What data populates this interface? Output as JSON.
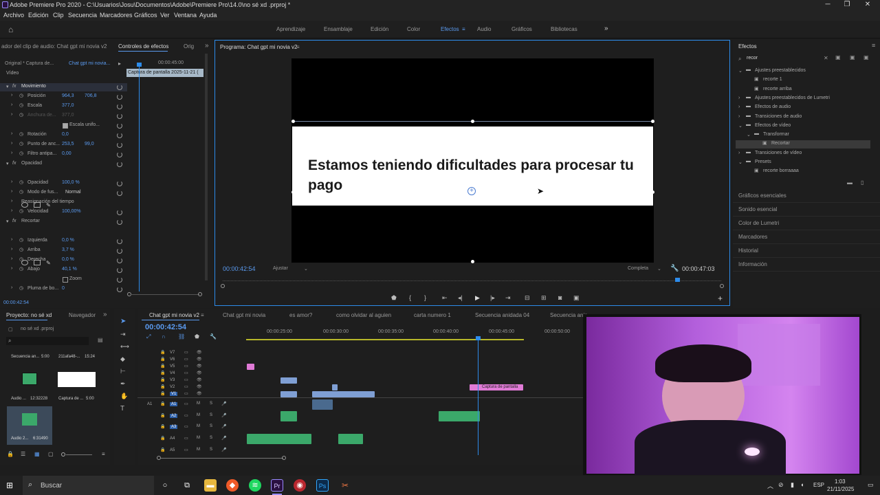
{
  "window": {
    "title": "Adobe Premiere Pro 2020 - C:\\Usuarios\\Josu\\Documentos\\Adobe\\Premiere Pro\\14.0\\no sé xd .prproj *"
  },
  "menu": [
    "Archivo",
    "Edición",
    "Clip",
    "Secuencia",
    "Marcadores",
    "Gráficos",
    "Ver",
    "Ventana",
    "Ayuda"
  ],
  "workspaces": {
    "items": [
      "Aprendizaje",
      "Ensamblaje",
      "Edición",
      "Color",
      "Efectos",
      "Audio",
      "Gráficos",
      "Bibliotecas"
    ],
    "active": "Efectos",
    "more": "»"
  },
  "effect_controls": {
    "tabs": [
      "ador del clip de audio: Chat gpt mi novia v2",
      "Controles de efectos",
      "Orig"
    ],
    "source": "Original * Captura de...",
    "sequence": "Chat gpt mi novia...",
    "timecode": "00:00:45:00",
    "clip_label": "Captura de pantalla 2025-11-21 (",
    "section_video": "Vídeo",
    "props": [
      {
        "label": "Movimiento",
        "type": "fx"
      },
      {
        "label": "Posición",
        "v1": "964,3",
        "v2": "706,8"
      },
      {
        "label": "Escala",
        "v1": "377,0"
      },
      {
        "label": "Anchura de...",
        "v1": "377,0"
      },
      {
        "label": "Escala unifo...",
        "checkbox": true
      },
      {
        "label": "Rotación",
        "v1": "0,0"
      },
      {
        "label": "Punto de anc...",
        "v1": "253,5",
        "v2": "99,0"
      },
      {
        "label": "Filtro antipa...",
        "v1": "0,00"
      },
      {
        "label": "Opacidad",
        "type": "fx"
      },
      {
        "label": "Opacidad",
        "v1": "100,0 %"
      },
      {
        "label": "Modo de fus...",
        "v1": "Normal"
      },
      {
        "label": "Reasignación del tiempo",
        "type": "section"
      },
      {
        "label": "Velocidad",
        "v1": "100,00%"
      },
      {
        "label": "Recortar",
        "type": "fx"
      },
      {
        "label": "Izquierda",
        "v1": "0,0 %"
      },
      {
        "label": "Arriba",
        "v1": "3,7 %"
      },
      {
        "label": "Derecha",
        "v1": "0,0 %"
      },
      {
        "label": "Abajo",
        "v1": "40,1 %"
      },
      {
        "label": "Zoom",
        "checkbox": true
      },
      {
        "label": "Pluma de bo...",
        "v1": "0"
      }
    ],
    "footer_time": "00:00:42:54"
  },
  "program": {
    "tab": "Programa: Chat gpt mi novia v2",
    "caption": "Estamos teniendo dificultades para procesar tu pago",
    "time_current": "00:00:42:54",
    "fit": "Ajustar",
    "quality": "Completa",
    "time_total": "00:00:47:03"
  },
  "effects_panel": {
    "title": "Efectos",
    "search": "recor",
    "tree": [
      {
        "label": "Ajustes preestablecidos",
        "level": 0,
        "open": true
      },
      {
        "label": "recorte 1",
        "level": 1
      },
      {
        "label": "recorte arriba",
        "level": 1
      },
      {
        "label": "Ajustes preestablecidos de Lumetri",
        "level": 0
      },
      {
        "label": "Efectos de audio",
        "level": 0
      },
      {
        "label": "Transiciones de audio",
        "level": 0
      },
      {
        "label": "Efectos de vídeo",
        "level": 0,
        "open": true
      },
      {
        "label": "Transformar",
        "level": 1,
        "open": true
      },
      {
        "label": "Recortar",
        "level": 2,
        "selected": true
      },
      {
        "label": "Transiciones de vídeo",
        "level": 0
      },
      {
        "label": "Presets",
        "level": 0,
        "open": true
      },
      {
        "label": "recorte borraaaa",
        "level": 1
      }
    ],
    "other_panels": [
      "Gráficos esenciales",
      "Sonido esencial",
      "Color de Lumetri",
      "Marcadores",
      "Historial",
      "Información"
    ]
  },
  "project": {
    "tabs": [
      "Proyecto: no sé xd",
      "Navegador"
    ],
    "file": "no sé xd .prproj",
    "items": [
      {
        "name": "Secuencia an...",
        "dur": "5:00"
      },
      {
        "name": "211afa48-...",
        "dur": "15:24"
      },
      {
        "name": "Audio ...",
        "dur": "12:32228"
      },
      {
        "name": "Captura de ...",
        "dur": "5:00"
      },
      {
        "name": "Audio 2...",
        "dur": "6:31490"
      }
    ]
  },
  "timeline": {
    "tabs": [
      "Chat gpt mi novia v2",
      "Chat gpt mi novia",
      "es amor?",
      "como olvidar al aguien",
      "carta numero 1",
      "Secuencia anidada 04",
      "Secuencia anic"
    ],
    "timecode": "00:00:42:54",
    "ruler": [
      "00:00:25:00",
      "00:00:30:00",
      "00:00:35:00",
      "00:00:40:00",
      "00:00:45:00",
      "00:00:50:00"
    ],
    "video_tracks": [
      "V7",
      "V6",
      "V5",
      "V4",
      "V3",
      "V2",
      "V1"
    ],
    "audio_tracks": [
      "A1",
      "A2",
      "A3",
      "A4",
      "A5"
    ],
    "source_patch": "A1",
    "clip_label": "Captura de pantalla"
  },
  "taskbar": {
    "search": "Buscar",
    "lang": "ESP",
    "time": "1:03",
    "date": "21/11/2025"
  },
  "colors": {
    "accent": "#2d8ceb",
    "timecode": "#5b9bf0",
    "video_clip": "#7f9fd4",
    "audio_clip": "#3ba86a",
    "pink_clip": "#e07ad6",
    "webcam_bg": "#b35fdc"
  }
}
